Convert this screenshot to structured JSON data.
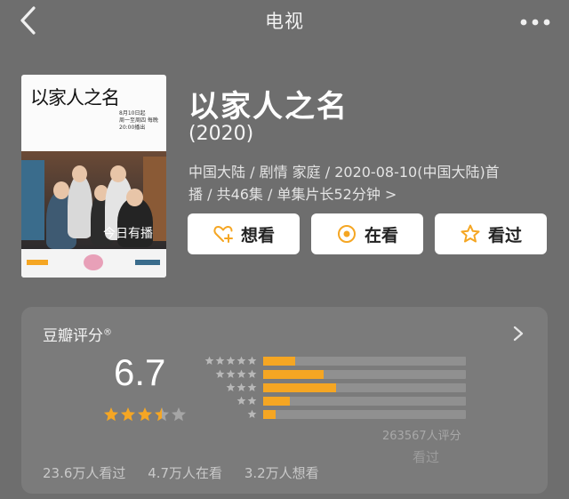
{
  "header": {
    "title": "电视",
    "back_icon": "chevron-left-icon",
    "more_icon": "more-dots-icon"
  },
  "poster": {
    "title_art": "以家人之名",
    "subtitle_art": "8月10日起\n周一至周四 每晚20:00播出",
    "handwriting": "今日有播",
    "brand_colors": [
      "#f5a623",
      "#3a6c8c"
    ]
  },
  "show": {
    "name": "以家人之名",
    "year": "(2020)",
    "meta_line1": "中国大陆 / 剧情 家庭 / 2020-08-10(中国大陆)首",
    "meta_line2": "播 / 共46集 / 单集片长52分钟 >"
  },
  "actions": [
    {
      "label": "想看",
      "icon": "heart-plus-icon"
    },
    {
      "label": "在看",
      "icon": "target-circle-icon"
    },
    {
      "label": "看过",
      "icon": "star-outline-icon"
    }
  ],
  "rating": {
    "title": "豆瓣评分",
    "mark": "®",
    "score": "6.7",
    "stars_value": 3.5,
    "star_color": "#f5a623",
    "distribution": [
      {
        "stars": 5,
        "fraction": 0.16
      },
      {
        "stars": 4,
        "fraction": 0.3
      },
      {
        "stars": 3,
        "fraction": 0.36
      },
      {
        "stars": 2,
        "fraction": 0.13
      },
      {
        "stars": 1,
        "fraction": 0.06
      }
    ],
    "count_text": "263567人评分",
    "watermark": "看过"
  },
  "stats": {
    "watched": "23.6万人看过",
    "watching": "4.7万人在看",
    "want": "3.2万人想看"
  }
}
